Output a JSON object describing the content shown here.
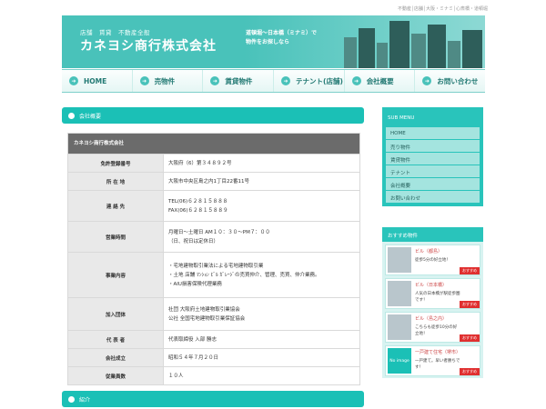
{
  "topline": "不動産│店舗│大阪・ミナミ│心斎橋・道頓堀",
  "header": {
    "tagline": "店舗　賃貸　不動産全般",
    "company": "カネヨシ商行株式会社",
    "catch1": "道頓堀～日本橋（ミナミ）で",
    "catch2": "物件をお探しなら"
  },
  "nav": [
    "HOME",
    "売物件",
    "賃貸物件",
    "テナント(店舗)",
    "会社概要",
    "お問い合わせ"
  ],
  "content": {
    "bar": "会社概要",
    "table_caption": "カネヨシ商行株式会社",
    "rows": [
      {
        "label": "免許登録番号",
        "value": "大阪府（6）第３４８９２号"
      },
      {
        "label": "所 在 地",
        "value": "大阪市中央区島之内1丁目22番11号"
      },
      {
        "label": "連 絡 先",
        "value": "TEL(06)６２８１５８８８",
        "value2": "FAX(06)６２８１５８８９"
      },
      {
        "label": "営業時間",
        "value": "月曜日～土曜日 AM１０：３０～PM７：００",
        "value2": "（日、祝日は定休日）"
      },
      {
        "label": "事業内容",
        "value": "・宅地建物取引業法による宅地建物取引業",
        "value2": "・土地 店舗 ﾏﾝｼｮﾝ ﾋﾞﾙ ｶﾞﾚｰｼﾞの売買仲介、管理、売買、仲介業務。",
        "value3": "・AIU損害保険代理業務"
      },
      {
        "label": "加入団体",
        "value": "社団 大阪府土地建物取引業協会",
        "value2": "公社 全国宅地建物取引業保証協会"
      },
      {
        "label": "代 表 者",
        "value": "代表取締役 入部 勝志"
      },
      {
        "label": "会社成立",
        "value": "昭和５４年７月２０日"
      },
      {
        "label": "従業員数",
        "value": "１０人"
      }
    ],
    "footer_bar": "紹介"
  },
  "sidebar": {
    "head": "SUB MENU",
    "items": [
      "HOME",
      "売り物件",
      "賃貸物件",
      "テナント",
      "会社概要",
      "お問い合わせ"
    ],
    "rec_head": "おすすめ物件",
    "recs": [
      {
        "title": "ビル（都島）",
        "desc": "徒歩5分の好立地！",
        "badge": "おすすめ"
      },
      {
        "title": "ビル（日本橋）",
        "desc": "人気の日本橋が駅徒歩圏です！",
        "badge": "おすすめ"
      },
      {
        "title": "ビル（島之内）",
        "desc": "こちらも徒歩10分の好立地！",
        "badge": "おすすめ"
      },
      {
        "title": "一戸建て住宅（堺市）",
        "desc": "一戸建て。早い者勝ちです！",
        "thumb": "No image",
        "badge": "おすすめ"
      }
    ]
  }
}
